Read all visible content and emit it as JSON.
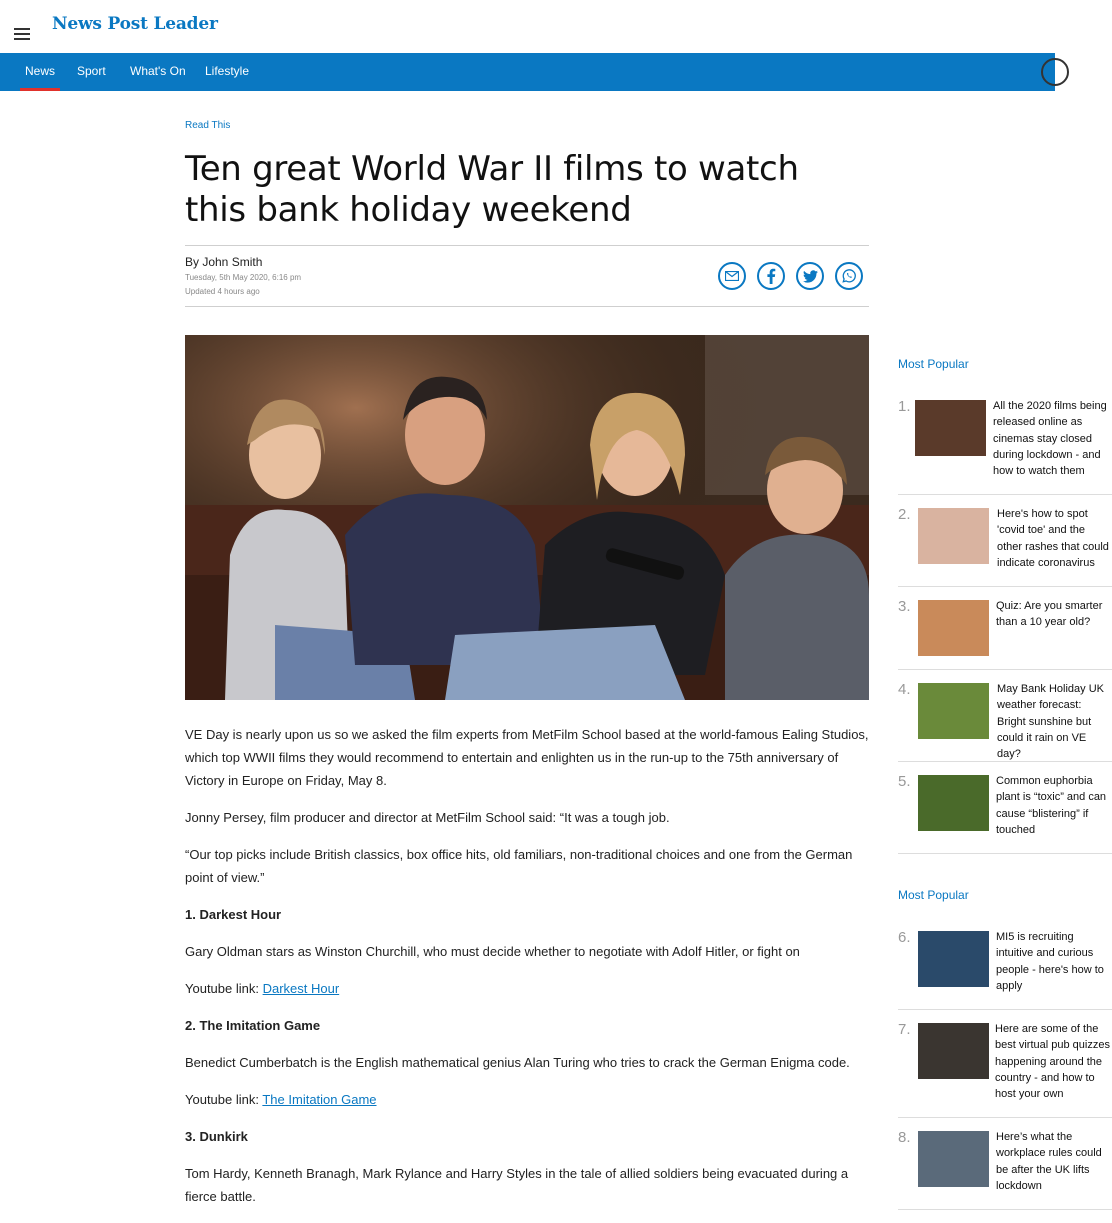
{
  "header": {
    "logo": "News Post Leader",
    "nav": [
      "News",
      "Sport",
      "What's On",
      "Lifestyle"
    ]
  },
  "article": {
    "kicker": "Read This",
    "title": "Ten great World War II films to watch this bank holiday weekend",
    "byline": "By John Smith",
    "date": "Tuesday, 5th May 2020, 6:16 pm",
    "updated": "Updated  4 hours ago",
    "paragraphs": {
      "p1": "VE Day is nearly upon us so we asked the film experts from MetFilm School based at the world-famous Ealing Studios, which top WWII films they would recommend to entertain and enlighten us in the run-up to the 75th anniversary of Victory in Europe on Friday, May 8.",
      "p2": "Jonny Persey, film producer and director at MetFilm School said: “It was a tough job.",
      "p3": "“Our top picks include British classics, box office hits, old familiars, non-traditional choices and one from the German point of view.”",
      "h1": "1. Darkest Hour",
      "p4": "Gary Oldman stars as Winston Churchill, who must decide whether to negotiate with Adolf Hitler, or fight on",
      "yt_label": "Youtube link: ",
      "yt1": "Darkest Hour",
      "h2": "2. The Imitation Game",
      "p5": "Benedict Cumberbatch is the English mathematical genius Alan Turing who tries to crack the German Enigma code.",
      "yt2": "The Imitation Game",
      "h3": "3. Dunkirk",
      "p6": "Tom Hardy, Kenneth Branagh, Mark Rylance and Harry Styles in the tale of allied soldiers being evacuated during a fierce battle."
    }
  },
  "sidebar": {
    "title1": "Most Popular",
    "title2": "Most Popular",
    "items": [
      {
        "num": "1.",
        "text": "All the 2020 films being released online as cinemas stay closed during lockdown - and how to watch them",
        "color": "#5a3a2a"
      },
      {
        "num": "2.",
        "text": "Here's how to spot 'covid toe' and the other rashes that could indicate coronavirus",
        "color": "#d9b3a0"
      },
      {
        "num": "3.",
        "text": "Quiz: Are you smarter than a 10 year old?",
        "color": "#c98a5a"
      },
      {
        "num": "4.",
        "text": "May Bank Holiday UK weather forecast: Bright sunshine but could it rain on VE day?",
        "color": "#6a8a3a"
      },
      {
        "num": "5.",
        "text": "Common euphorbia plant is “toxic” and can cause “blistering” if touched",
        "color": "#4a6a2a"
      },
      {
        "num": "6.",
        "text": "MI5 is recruiting intuitive and curious people - here's how to apply",
        "color": "#2a4a6a"
      },
      {
        "num": "7.",
        "text": "Here are some of the best virtual pub quizzes happening around the country - and how to host your own",
        "color": "#3a3530"
      },
      {
        "num": "8.",
        "text": "Here’s what the workplace rules could be after the UK lifts lockdown",
        "color": "#5a6a7a"
      }
    ]
  }
}
